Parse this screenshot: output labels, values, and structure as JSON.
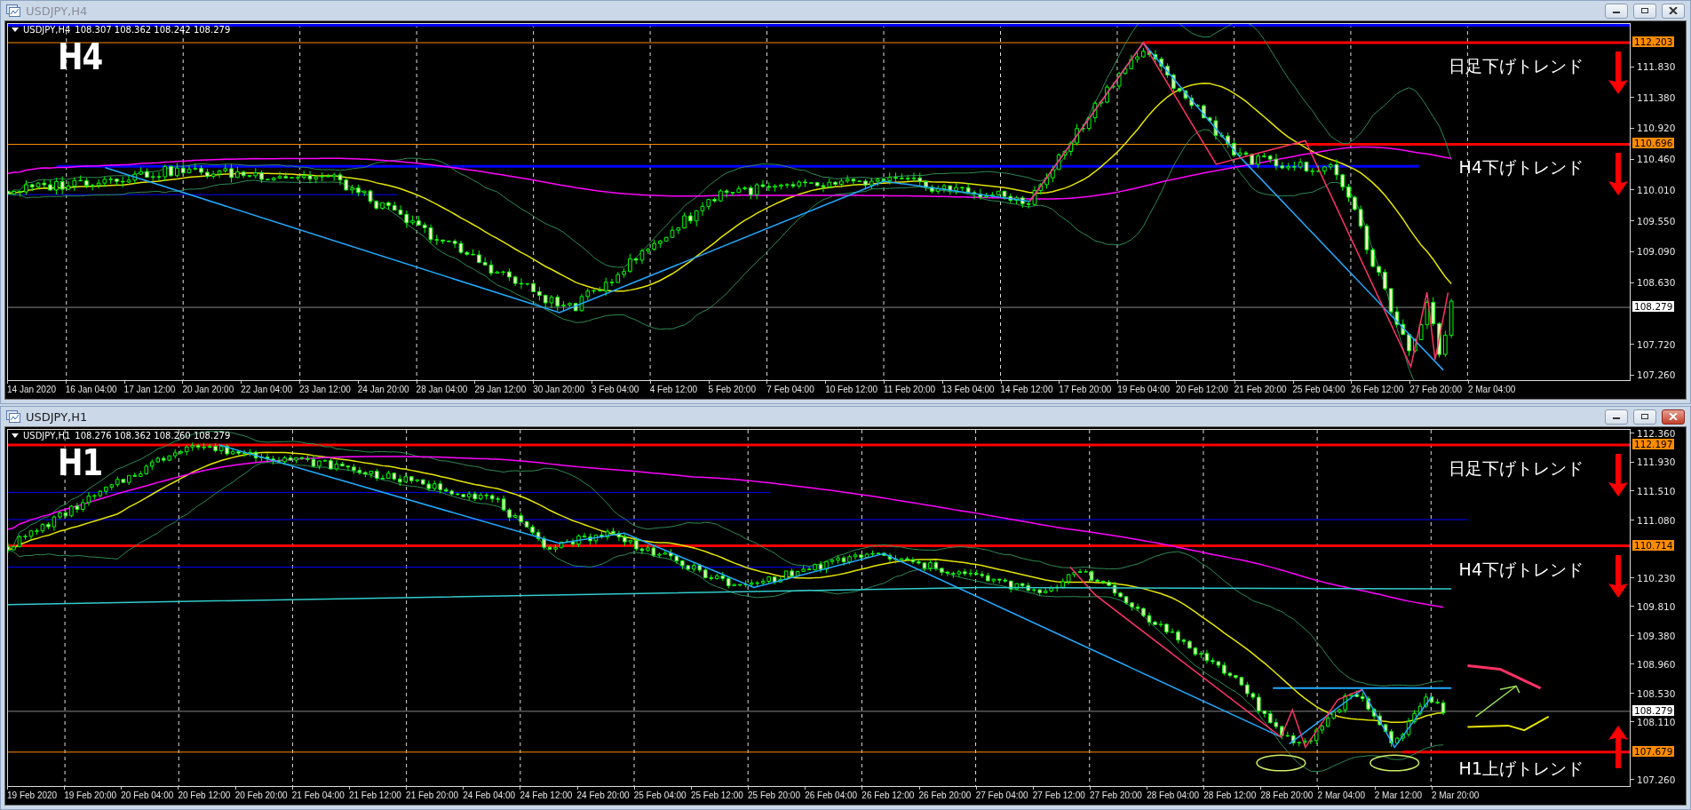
{
  "windows": [
    {
      "title": "USDJPY,H4",
      "active": false,
      "symbol": "USDJPY,H4",
      "quotes": "108.307 108.362 108.242 108.279",
      "timeframe_label": "H4",
      "price_ticks": [
        "111.830",
        "111.380",
        "110.920",
        "110.460",
        "110.010",
        "109.550",
        "109.090",
        "108.630",
        "107.720",
        "107.260"
      ],
      "price_tags": [
        {
          "label": "112.203",
          "kind": "level"
        },
        {
          "label": "110.696",
          "kind": "level"
        },
        {
          "label": "108.279",
          "kind": "bid"
        }
      ],
      "annotations": [
        {
          "text": "日足下げトレンド",
          "arrow_up": false
        },
        {
          "text": "H4下げトレンド",
          "arrow_up": false
        }
      ],
      "time_labels": [
        "14 Jan 2020",
        "16 Jan 04:00",
        "17 Jan 12:00",
        "20 Jan 20:00",
        "22 Jan 04:00",
        "23 Jan 12:00",
        "24 Jan 20:00",
        "28 Jan 04:00",
        "29 Jan 12:00",
        "30 Jan 20:00",
        "3 Feb 04:00",
        "4 Feb 12:00",
        "5 Feb 20:00",
        "7 Feb 04:00",
        "10 Feb 12:00",
        "11 Feb 20:00",
        "13 Feb 04:00",
        "14 Feb 12:00",
        "17 Feb 20:00",
        "19 Feb 04:00",
        "20 Feb 12:00",
        "21 Feb 20:00",
        "25 Feb 04:00",
        "26 Feb 12:00",
        "27 Feb 20:00",
        "2 Mar 04:00"
      ]
    },
    {
      "title": "USDJPY,H1",
      "active": true,
      "symbol": "USDJPY,H1",
      "quotes": "108.276 108.362 108.260 108.279",
      "timeframe_label": "H1",
      "price_ticks": [
        "112.360",
        "111.930",
        "111.510",
        "111.080",
        "110.230",
        "109.810",
        "109.380",
        "108.960",
        "108.530",
        "108.110",
        "107.260"
      ],
      "price_tags": [
        {
          "label": "112.197",
          "kind": "level"
        },
        {
          "label": "110.714",
          "kind": "level"
        },
        {
          "label": "108.279",
          "kind": "bid"
        },
        {
          "label": "107.679",
          "kind": "level"
        }
      ],
      "annotations": [
        {
          "text": "日足下げトレンド",
          "arrow_up": false
        },
        {
          "text": "H4下げトレンド",
          "arrow_up": false
        },
        {
          "text": "H1上げトレンド",
          "arrow_up": true
        }
      ],
      "time_labels": [
        "19 Feb 2020",
        "19 Feb 20:00",
        "20 Feb 04:00",
        "20 Feb 12:00",
        "20 Feb 20:00",
        "21 Feb 04:00",
        "21 Feb 12:00",
        "21 Feb 20:00",
        "24 Feb 04:00",
        "24 Feb 12:00",
        "24 Feb 20:00",
        "25 Feb 04:00",
        "25 Feb 12:00",
        "25 Feb 20:00",
        "26 Feb 04:00",
        "26 Feb 12:00",
        "26 Feb 20:00",
        "27 Feb 04:00",
        "27 Feb 12:00",
        "27 Feb 20:00",
        "28 Feb 04:00",
        "28 Feb 12:00",
        "28 Feb 20:00",
        "2 Mar 04:00",
        "2 Mar 12:00",
        "2 Mar 20:00"
      ]
    }
  ]
}
